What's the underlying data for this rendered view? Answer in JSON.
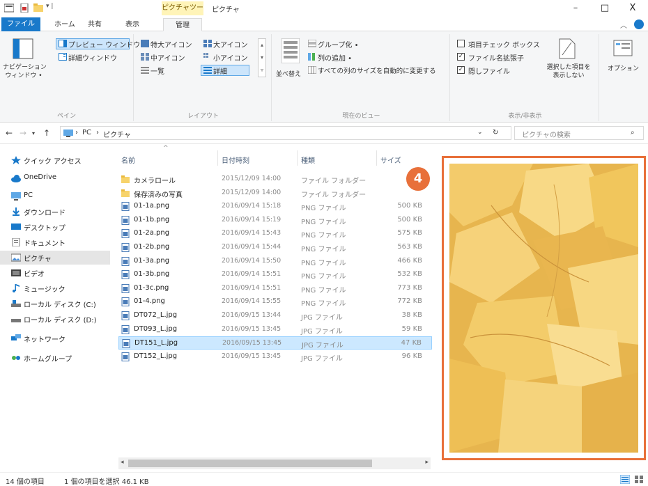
{
  "window": {
    "title": "ピクチャ",
    "context_tab_label": "ピクチャツール",
    "minimize": "–",
    "maximize": "□",
    "close": "X"
  },
  "tabs": [
    {
      "label": "ファイル"
    },
    {
      "label": "ホーム"
    },
    {
      "label": "共有"
    },
    {
      "label": "表示"
    },
    {
      "label": "管理"
    }
  ],
  "ribbon": {
    "pane": {
      "nav_pane_label": "ナビゲーション\nウィンドウ •",
      "preview_pane": "プレビュー ウィンドウ",
      "details_pane": "詳細ウィンドウ",
      "group_label": "ペイン"
    },
    "layout": {
      "items": [
        "特大アイコン",
        "大アイコン",
        "中アイコン",
        "小アイコン",
        "一覧",
        "詳細"
      ],
      "group_label": "レイアウト"
    },
    "current_view": {
      "sort_by": "並べ替え",
      "group_by": "グループ化 •",
      "add_columns": "列の追加 •",
      "size_all_columns": "すべての列のサイズを自動的に変更する",
      "group_label": "現在のビュー"
    },
    "show_hide": {
      "item_checkboxes": "項目チェック ボックス",
      "file_extensions": "ファイル名拡張子",
      "hidden_items": "隠しファイル",
      "hide_selected": "選択した項目を\n表示しない",
      "group_label": "表示/非表示"
    },
    "options": "オプション"
  },
  "address": {
    "crumbs": [
      "PC",
      "ピクチャ"
    ],
    "search_placeholder": "ピクチャの検索"
  },
  "nav_pane": [
    {
      "label": "クイック アクセス",
      "icon": "star-icon"
    },
    {
      "label": "OneDrive",
      "icon": "cloud-icon"
    },
    {
      "label": "PC",
      "icon": "pc-icon"
    },
    {
      "label": "ダウンロード",
      "icon": "download-icon"
    },
    {
      "label": "デスクトップ",
      "icon": "desktop-icon"
    },
    {
      "label": "ドキュメント",
      "icon": "document-icon"
    },
    {
      "label": "ピクチャ",
      "icon": "picture-icon"
    },
    {
      "label": "ビデオ",
      "icon": "video-icon"
    },
    {
      "label": "ミュージック",
      "icon": "music-icon"
    },
    {
      "label": "ローカル ディスク (C:)",
      "icon": "disk-icon"
    },
    {
      "label": "ローカル ディスク (D:)",
      "icon": "disk-icon"
    },
    {
      "label": "ネットワーク",
      "icon": "network-icon"
    },
    {
      "label": "ホームグループ",
      "icon": "homegroup-icon"
    }
  ],
  "file_list": {
    "columns": [
      "名前",
      "日付時刻",
      "種類",
      "サイズ"
    ],
    "rows": [
      {
        "name": "カメラロール",
        "date": "2015/12/09 14:00",
        "type": "ファイル フォルダー",
        "size": "",
        "kind": "folder"
      },
      {
        "name": "保存済みの写真",
        "date": "2015/12/09 14:00",
        "type": "ファイル フォルダー",
        "size": "",
        "kind": "folder"
      },
      {
        "name": "01-1a.png",
        "date": "2016/09/14 15:18",
        "type": "PNG ファイル",
        "size": "500 KB",
        "kind": "image"
      },
      {
        "name": "01-1b.png",
        "date": "2016/09/14 15:19",
        "type": "PNG ファイル",
        "size": "500 KB",
        "kind": "image"
      },
      {
        "name": "01-2a.png",
        "date": "2016/09/14 15:43",
        "type": "PNG ファイル",
        "size": "575 KB",
        "kind": "image"
      },
      {
        "name": "01-2b.png",
        "date": "2016/09/14 15:44",
        "type": "PNG ファイル",
        "size": "563 KB",
        "kind": "image"
      },
      {
        "name": "01-3a.png",
        "date": "2016/09/14 15:50",
        "type": "PNG ファイル",
        "size": "466 KB",
        "kind": "image"
      },
      {
        "name": "01-3b.png",
        "date": "2016/09/14 15:51",
        "type": "PNG ファイル",
        "size": "532 KB",
        "kind": "image"
      },
      {
        "name": "01-3c.png",
        "date": "2016/09/14 15:51",
        "type": "PNG ファイル",
        "size": "773 KB",
        "kind": "image"
      },
      {
        "name": "01-4.png",
        "date": "2016/09/14 15:55",
        "type": "PNG ファイル",
        "size": "772 KB",
        "kind": "image"
      },
      {
        "name": "DT072_L.jpg",
        "date": "2016/09/15 13:44",
        "type": "JPG ファイル",
        "size": "38 KB",
        "kind": "image"
      },
      {
        "name": "DT093_L.jpg",
        "date": "2016/09/15 13:45",
        "type": "JPG ファイル",
        "size": "59 KB",
        "kind": "image"
      },
      {
        "name": "DT151_L.jpg",
        "date": "2016/09/15 13:45",
        "type": "JPG ファイル",
        "size": "47 KB",
        "kind": "image",
        "selected": true
      },
      {
        "name": "DT152_L.jpg",
        "date": "2016/09/15 13:45",
        "type": "JPG ファイル",
        "size": "96 KB",
        "kind": "image"
      }
    ]
  },
  "preview": {
    "step_badge": "4"
  },
  "status": {
    "item_count": "14 個の項目",
    "selection": "1 個の項目を選択 46.1 KB"
  },
  "colors": {
    "accent": "#1979ca",
    "highlight": "#e8703a",
    "selection": "#cce8ff",
    "context_tab": "#fff4b8"
  }
}
